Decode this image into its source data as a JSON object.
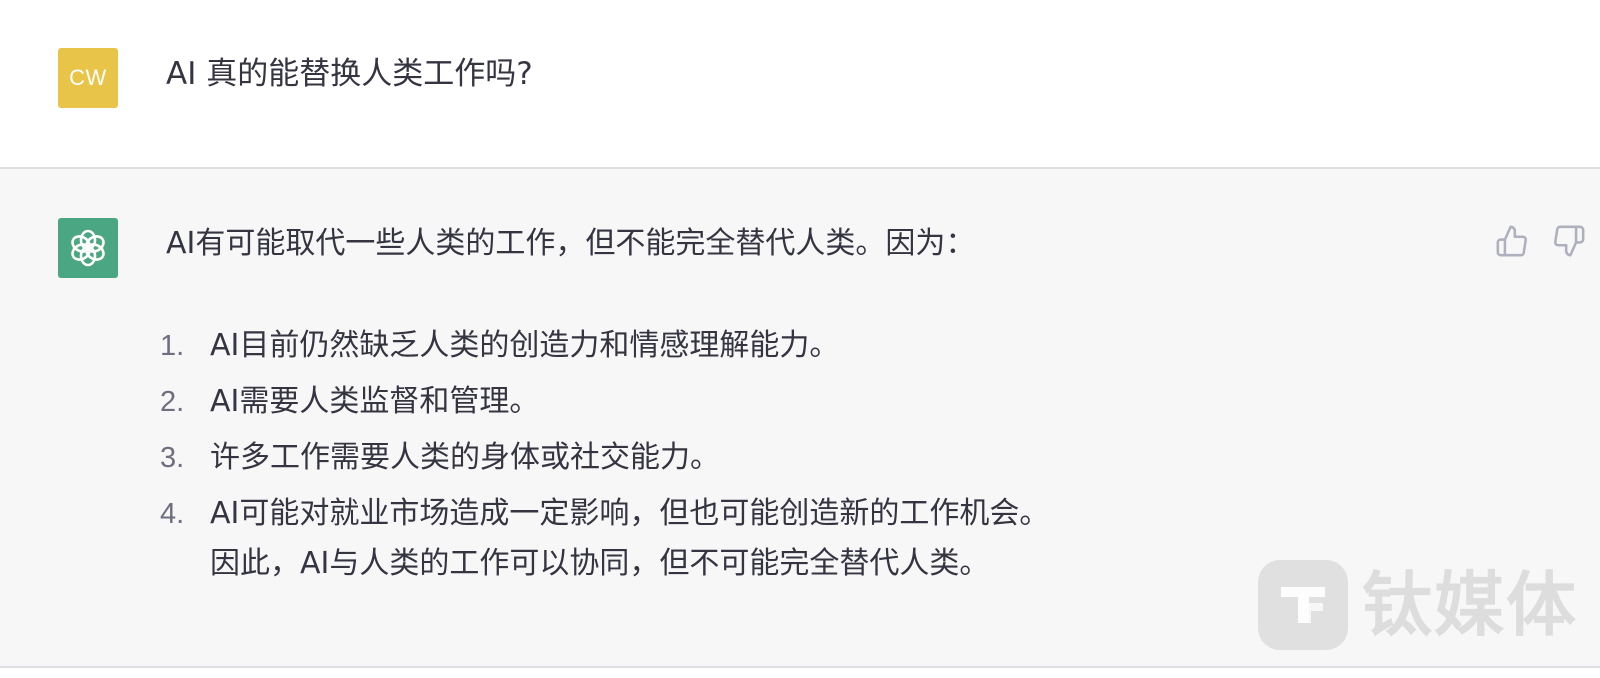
{
  "conversation": {
    "user": {
      "avatar_initials": "CW",
      "avatar_color": "#e8c449",
      "message": "AI 真的能替换人类工作吗?"
    },
    "assistant": {
      "avatar_icon": "openai-logo-icon",
      "avatar_color": "#4aa683",
      "intro": "AI有可能取代一些人类的工作，但不能完全替代人类。因为：",
      "items": [
        {
          "number": "1.",
          "text": "AI目前仍然缺乏人类的创造力和情感理解能力。"
        },
        {
          "number": "2.",
          "text": "AI需要人类监督和管理。"
        },
        {
          "number": "3.",
          "text": "许多工作需要人类的身体或社交能力。"
        },
        {
          "number": "4.",
          "text": "AI可能对就业市场造成一定影响，但也可能创造新的工作机会。"
        }
      ],
      "conclusion": "因此，AI与人类的工作可以协同，但不可能完全替代人类。",
      "feedback": {
        "thumbs_up_icon": "thumbs-up-icon",
        "thumbs_down_icon": "thumbs-down-icon"
      }
    }
  },
  "watermark": {
    "text": "钛媒体",
    "logo_icon": "tmtpost-logo-icon"
  },
  "colors": {
    "assistant_bg": "#f7f7f8",
    "text": "#343541",
    "icon_gray": "#aeb0bd"
  }
}
